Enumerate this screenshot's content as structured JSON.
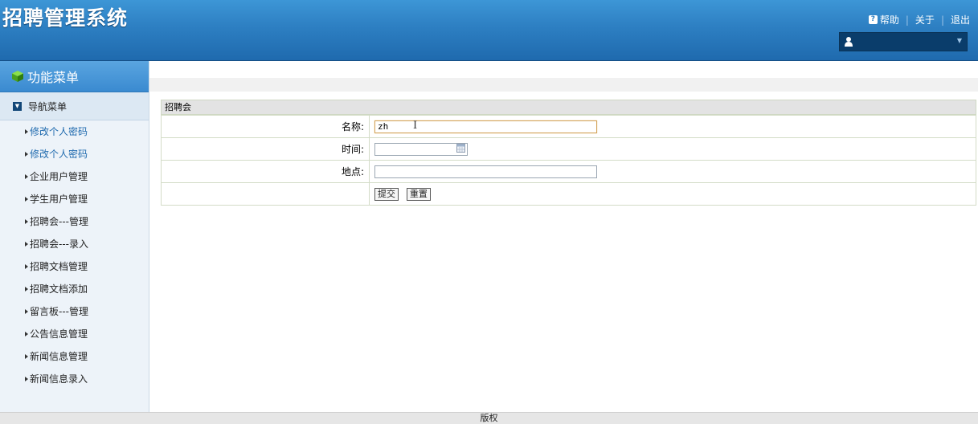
{
  "header": {
    "title": "招聘管理系统",
    "links": {
      "help": "帮助",
      "about": "关于",
      "logout": "退出"
    },
    "user_label": ""
  },
  "sidebar": {
    "title": "功能菜单",
    "nav_header": "导航菜单",
    "items": [
      {
        "label": "修改个人密码"
      },
      {
        "label": "修改个人密码"
      },
      {
        "label": "企业用户管理"
      },
      {
        "label": "学生用户管理"
      },
      {
        "label": "招聘会---管理"
      },
      {
        "label": "招聘会---录入"
      },
      {
        "label": "招聘文档管理"
      },
      {
        "label": "招聘文档添加"
      },
      {
        "label": "留言板---管理"
      },
      {
        "label": "公告信息管理"
      },
      {
        "label": "新闻信息管理"
      },
      {
        "label": "新闻信息录入"
      }
    ]
  },
  "form": {
    "panel_title": "招聘会",
    "name_label": "名称:",
    "name_value": "zh",
    "time_label": "时间:",
    "time_value": "",
    "place_label": "地点:",
    "place_value": "",
    "submit_label": "提交",
    "reset_label": "重置"
  },
  "footer": {
    "text": "版权"
  },
  "colors": {
    "header_blue": "#2d7fc2",
    "link_blue": "#1f6aae",
    "sidebar_bg": "#edf3f9"
  }
}
